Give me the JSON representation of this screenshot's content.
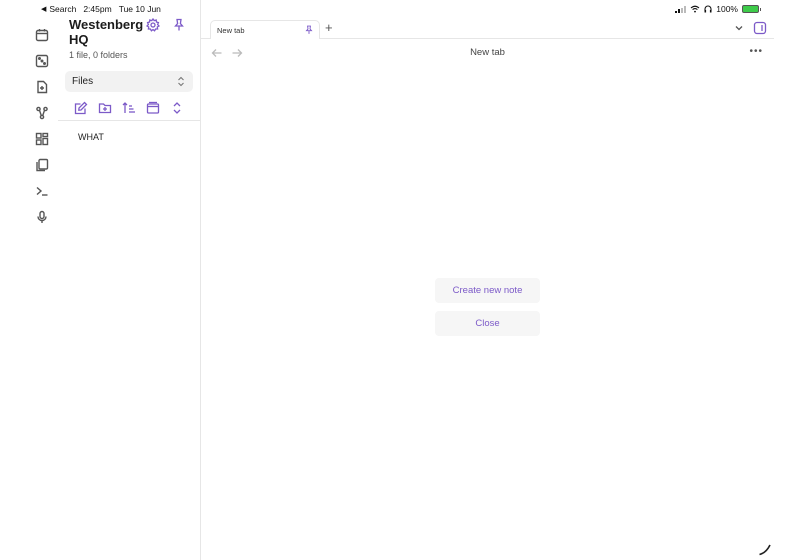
{
  "status_bar": {
    "back_label": "Search",
    "time": "2:45pm",
    "date": "Tue 10 Jun",
    "battery": "100%"
  },
  "ribbon": {
    "icons": [
      "calendar-icon",
      "random-note-icon",
      "document-import-icon",
      "graph-view-icon",
      "canvas-icon",
      "templates-icon",
      "command-palette-icon",
      "microphone-icon"
    ]
  },
  "sidebar": {
    "vault_name": "Westenberg HQ",
    "vault_stats": "1 file, 0 folders",
    "view_selector": "Files",
    "files": [
      {
        "name": "WHAT"
      }
    ]
  },
  "tabs": [
    {
      "label": "New tab",
      "pinned": true
    }
  ],
  "main": {
    "title": "New tab",
    "create_note_label": "Create new note",
    "close_label": "Close"
  },
  "colors": {
    "accent": "#7c5ac8",
    "battery": "#3ecb4a"
  }
}
